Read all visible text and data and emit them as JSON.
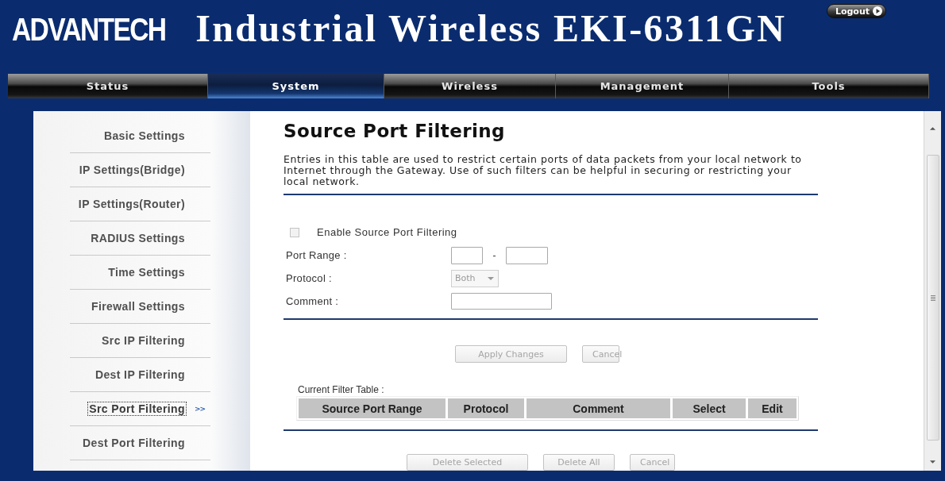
{
  "header": {
    "logo": "ADVANTECH",
    "title": "Industrial Wireless EKI-6311GN",
    "logout_button": "Logout"
  },
  "nav_tabs": [
    {
      "label": "Status",
      "selected": false
    },
    {
      "label": "System",
      "selected": true
    },
    {
      "label": "Wireless",
      "selected": false
    },
    {
      "label": "Management",
      "selected": false
    },
    {
      "label": "Tools",
      "selected": false
    }
  ],
  "sidebar": {
    "current_marker": ">>",
    "items": [
      {
        "label": "Basic Settings",
        "selected": false
      },
      {
        "label": "IP Settings(Bridge)",
        "selected": false
      },
      {
        "label": "IP Settings(Router)",
        "selected": false
      },
      {
        "label": "RADIUS Settings",
        "selected": false
      },
      {
        "label": "Time Settings",
        "selected": false
      },
      {
        "label": "Firewall Settings",
        "selected": false
      },
      {
        "label": "Src IP Filtering",
        "selected": false
      },
      {
        "label": "Dest IP Filtering",
        "selected": false
      },
      {
        "label": "Src Port Filtering",
        "selected": true
      },
      {
        "label": "Dest Port Filtering",
        "selected": false
      }
    ]
  },
  "main": {
    "title": "Source Port Filtering",
    "description": "Entries in this table are used to restrict certain ports of data packets from your local network to Internet through the Gateway. Use of such filters can be helpful in securing or restricting your local network.",
    "enable": {
      "label": "Enable Source Port Filtering",
      "checked": false
    },
    "fields": [
      {
        "kind": "range",
        "label": "Port Range :",
        "separator": "-"
      },
      {
        "kind": "select",
        "label": "Protocol :",
        "value": "Both",
        "disabled": true
      },
      {
        "kind": "text",
        "label": "Comment :"
      }
    ],
    "form_buttons": [
      {
        "label": "Apply Changes",
        "disabled": true
      },
      {
        "label": "Cancel",
        "disabled": true
      }
    ],
    "table": {
      "caption": "Current Filter Table :",
      "columns": [
        "Source Port Range",
        "Protocol",
        "Comment",
        "Select",
        "Edit"
      ]
    },
    "table_buttons": [
      {
        "label": "Delete Selected",
        "disabled": true
      },
      {
        "label": "Delete All",
        "disabled": true
      },
      {
        "label": "Cancel",
        "disabled": true
      }
    ]
  }
}
